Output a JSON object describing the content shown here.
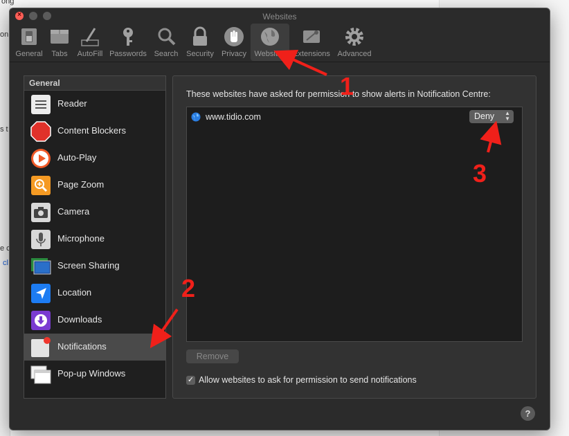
{
  "background": {
    "fragments": [
      "ong",
      "on",
      "s t",
      "e c",
      "cl"
    ]
  },
  "window": {
    "title": "Websites"
  },
  "toolbar": {
    "items": [
      {
        "label": "General",
        "icon": "general-switch-icon"
      },
      {
        "label": "Tabs",
        "icon": "tabs-icon"
      },
      {
        "label": "AutoFill",
        "icon": "autofill-pencil-icon"
      },
      {
        "label": "Passwords",
        "icon": "key-icon"
      },
      {
        "label": "Search",
        "icon": "magnifier-icon"
      },
      {
        "label": "Security",
        "icon": "lock-icon"
      },
      {
        "label": "Privacy",
        "icon": "hand-icon"
      },
      {
        "label": "Websites",
        "icon": "globe-icon",
        "selected": true
      },
      {
        "label": "Extensions",
        "icon": "puzzle-icon"
      },
      {
        "label": "Advanced",
        "icon": "gear-icon"
      }
    ]
  },
  "sidebar": {
    "header": "General",
    "items": [
      {
        "label": "Reader",
        "icon": "reader-icon"
      },
      {
        "label": "Content Blockers",
        "icon": "stop-sign-icon"
      },
      {
        "label": "Auto-Play",
        "icon": "play-icon"
      },
      {
        "label": "Page Zoom",
        "icon": "zoom-icon"
      },
      {
        "label": "Camera",
        "icon": "camera-icon"
      },
      {
        "label": "Microphone",
        "icon": "microphone-icon"
      },
      {
        "label": "Screen Sharing",
        "icon": "screen-sharing-icon"
      },
      {
        "label": "Location",
        "icon": "location-arrow-icon"
      },
      {
        "label": "Downloads",
        "icon": "download-icon"
      },
      {
        "label": "Notifications",
        "icon": "notifications-icon",
        "selected": true
      },
      {
        "label": "Pop-up Windows",
        "icon": "popup-windows-icon"
      }
    ]
  },
  "main": {
    "description": "These websites have asked for permission to show alerts in Notification Centre:",
    "sites": [
      {
        "name": "www.tidio.com",
        "permission": "Deny"
      }
    ],
    "remove_label": "Remove",
    "allow_label": "Allow websites to ask for permission to send notifications",
    "allow_checked": true,
    "help_label": "?"
  },
  "annotations": {
    "one": "1",
    "two": "2",
    "three": "3"
  },
  "colors": {
    "window_bg": "#2b2b2b",
    "annotation_red": "#f0201a",
    "close_red": "#fe5f57"
  }
}
